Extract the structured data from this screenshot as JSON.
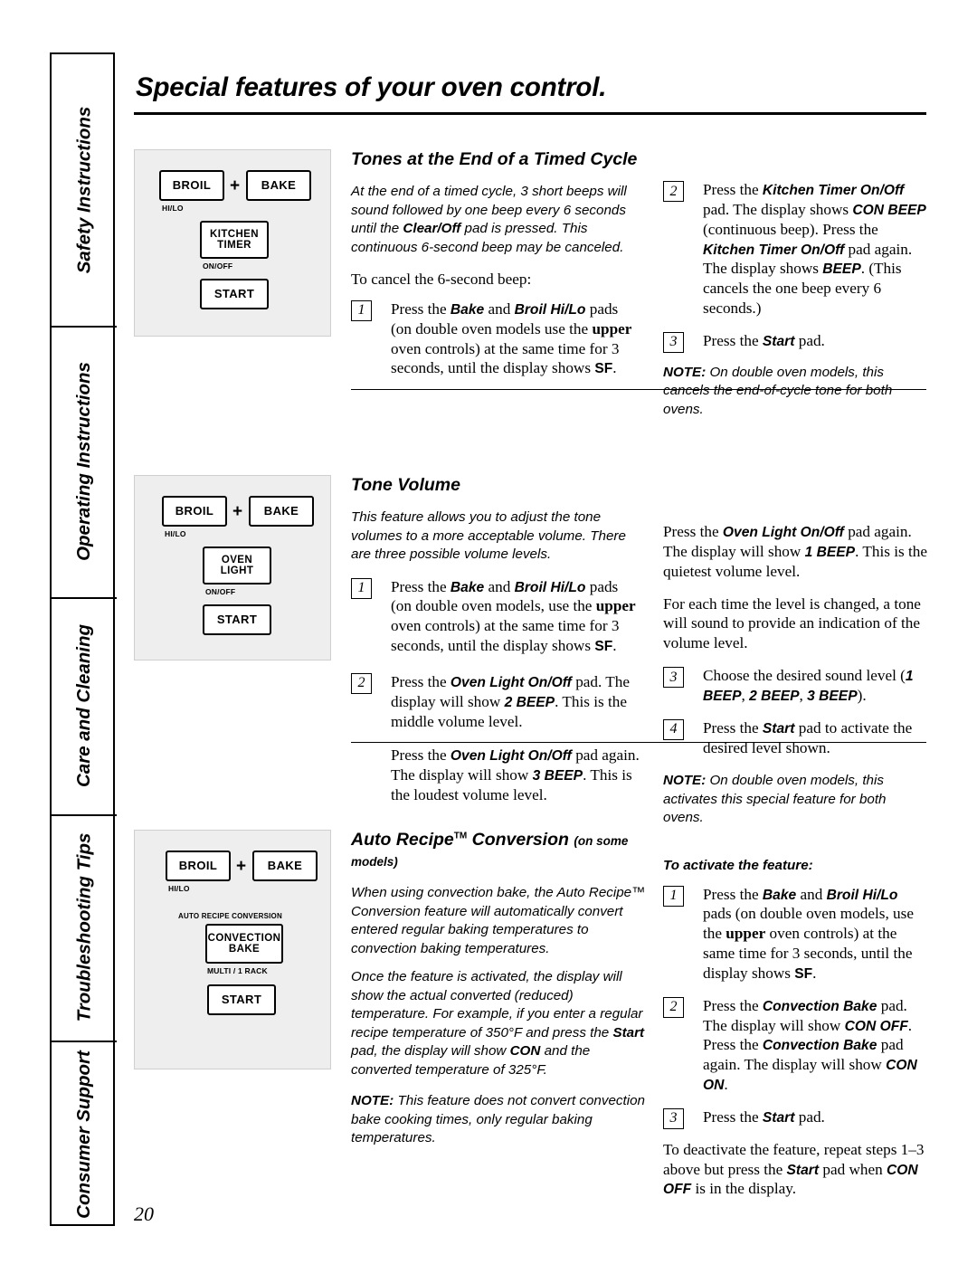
{
  "sidebar": {
    "items": [
      {
        "label": "Safety Instructions"
      },
      {
        "label": "Operating Instructions"
      },
      {
        "label": "Care and Cleaning"
      },
      {
        "label": "Troubleshooting Tips"
      },
      {
        "label": "Consumer Support"
      }
    ]
  },
  "page": {
    "title": "Special features of your oven control.",
    "number": "20"
  },
  "keypads": {
    "broil": "BROIL",
    "broil_sub": "HI/LO",
    "bake": "BAKE",
    "plus": "+",
    "kitchen": "KITCHEN",
    "timer": "TIMER",
    "onoff": "ON/OFF",
    "start": "START",
    "oven": "OVEN",
    "light": "LIGHT",
    "auto_recipe_conversion": "AUTO RECIPE CONVERSION",
    "convection": "CONVECTION",
    "bake2": "BAKE",
    "multi_rack": "MULTI / 1 RACK"
  },
  "section1": {
    "title": "Tones at the End of a Timed Cycle",
    "intro": "At the end of a timed cycle, 3 short beeps will sound followed by one beep every 6 seconds until the Clear/Off pad is pressed. This continuous 6-second beep may be canceled.",
    "intro_bold": "Clear/Off",
    "cancel_line": "To cancel the 6-second beep:",
    "steps": [
      {
        "num": "1",
        "text_pre": "Press the ",
        "b1": "Bake",
        "mid": " and ",
        "b2": "Broil Hi/Lo",
        "text_post": " pads (on double oven models use the upper oven controls) at the same time for 3 seconds, until the display shows SF."
      },
      {
        "num": "2",
        "text": "Press the Kitchen Timer On/Off pad. The display shows CON BEEP (continuous beep). Press the Kitchen Timer On/Off pad again. The display shows BEEP. (This cancels the one beep every 6 seconds.)"
      },
      {
        "num": "3",
        "text": "Press the Start pad."
      }
    ],
    "note": "NOTE: On double oven models, this cancels the end-of-cycle tone for both ovens."
  },
  "section2": {
    "title": "Tone Volume",
    "intro": "This feature allows you to adjust the tone volumes to a more acceptable volume. There are three possible volume levels.",
    "steps": [
      {
        "num": "1",
        "text": "Press the Bake and Broil Hi/Lo pads (on double oven models, use the upper oven controls) at the same time for 3 seconds, until the display shows SF."
      },
      {
        "num": "2",
        "text": "Press the Oven Light On/Off pad. The display will show 2 BEEP. This is the middle volume level."
      },
      {
        "num": "3",
        "text": "Choose the desired sound level (1 BEEP, 2 BEEP, 3 BEEP)."
      },
      {
        "num": "4",
        "text": "Press the Start pad to activate the desired level shown."
      }
    ],
    "para_loudest": "Press the Oven Light On/Off pad again. The display will show 3 BEEP. This is the loudest volume level.",
    "para_quietest": "Press the Oven Light On/Off pad again. The display will show 1 BEEP. This is the quietest volume level.",
    "para_eachtime": "For each time the level is changed, a tone will sound to provide an indication of the volume level.",
    "note": "NOTE: On double oven models, this activates this special feature for both ovens."
  },
  "section3": {
    "title": "Auto Recipe",
    "title_tm": "TM",
    "title_rest": " Conversion",
    "title_note": "(on some models)",
    "p1": "When using convection bake, the Auto Recipe™ Conversion feature will automatically convert entered regular baking temperatures to convection baking temperatures.",
    "p2": "Once the feature is activated, the display will show the actual converted (reduced) temperature. For example, if you enter a regular recipe temperature of 350°F and press the Start pad, the display will show CON and the converted temperature of 325°F.",
    "note": "NOTE: This feature does not convert convection bake cooking times, only regular baking temperatures.",
    "activate_heading": "To activate the feature:",
    "steps": [
      {
        "num": "1",
        "text": "Press the Bake and Broil Hi/Lo pads (on double oven models, use the upper oven controls) at the same time for 3 seconds, until the display shows SF."
      },
      {
        "num": "2",
        "text": "Press the Convection Bake pad. The display will show CON OFF. Press the Convection Bake pad again. The display will show CON ON."
      },
      {
        "num": "3",
        "text": "Press the Start pad."
      }
    ],
    "deactivate": "To deactivate the feature, repeat steps 1–3 above but press the Start pad when CON OFF is in the display."
  }
}
